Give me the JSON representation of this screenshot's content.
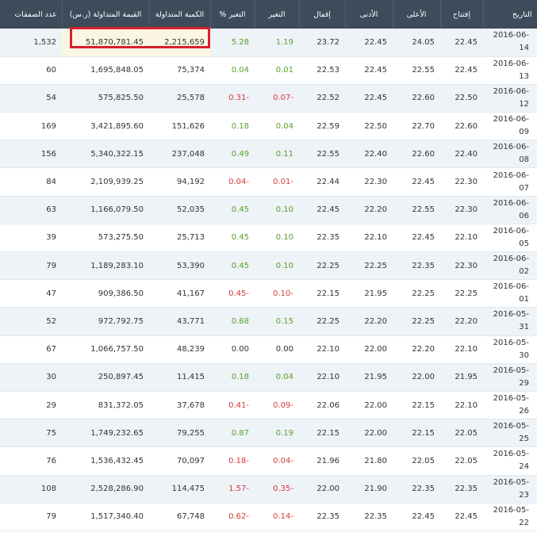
{
  "headers": {
    "trades": "عدد الصفقات",
    "value": "القيمة المتداولة (ر.س)",
    "volume": "الكمية المتداولة",
    "change_pct": "% التغير",
    "change": "التغير",
    "close": "إقفال",
    "low": "الأدنى",
    "high": "الأعلى",
    "open": "إفتتاح",
    "date": "التاريخ"
  },
  "rows": [
    {
      "trades": "1,532",
      "value": "51,870,781.45",
      "volume": "2,215,659",
      "pct": "5.28",
      "chg": "1.19",
      "close": "23.72",
      "low": "22.45",
      "high": "24.05",
      "open": "22.45",
      "date": "2016-06-14",
      "dir": "pos"
    },
    {
      "trades": "60",
      "value": "1,695,848.05",
      "volume": "75,374",
      "pct": "0.04",
      "chg": "0.01",
      "close": "22.53",
      "low": "22.45",
      "high": "22.55",
      "open": "22.45",
      "date": "2016-06-13",
      "dir": "pos"
    },
    {
      "trades": "54",
      "value": "575,825.50",
      "volume": "25,578",
      "pct": "0.31-",
      "chg": "0.07-",
      "close": "22.52",
      "low": "22.45",
      "high": "22.60",
      "open": "22.50",
      "date": "2016-06-12",
      "dir": "neg"
    },
    {
      "trades": "169",
      "value": "3,421,895.60",
      "volume": "151,626",
      "pct": "0.18",
      "chg": "0.04",
      "close": "22.59",
      "low": "22.50",
      "high": "22.70",
      "open": "22.60",
      "date": "2016-06-09",
      "dir": "pos"
    },
    {
      "trades": "156",
      "value": "5,340,322.15",
      "volume": "237,048",
      "pct": "0.49",
      "chg": "0.11",
      "close": "22.55",
      "low": "22.40",
      "high": "22.60",
      "open": "22.40",
      "date": "2016-06-08",
      "dir": "pos"
    },
    {
      "trades": "84",
      "value": "2,109,939.25",
      "volume": "94,192",
      "pct": "0.04-",
      "chg": "0.01-",
      "close": "22.44",
      "low": "22.30",
      "high": "22.45",
      "open": "22.30",
      "date": "2016-06-07",
      "dir": "neg"
    },
    {
      "trades": "63",
      "value": "1,166,079.50",
      "volume": "52,035",
      "pct": "0.45",
      "chg": "0.10",
      "close": "22.45",
      "low": "22.20",
      "high": "22.55",
      "open": "22.30",
      "date": "2016-06-06",
      "dir": "pos"
    },
    {
      "trades": "39",
      "value": "573,275.50",
      "volume": "25,713",
      "pct": "0.45",
      "chg": "0.10",
      "close": "22.35",
      "low": "22.10",
      "high": "22.45",
      "open": "22.10",
      "date": "2016-06-05",
      "dir": "pos"
    },
    {
      "trades": "79",
      "value": "1,189,283.10",
      "volume": "53,390",
      "pct": "0.45",
      "chg": "0.10",
      "close": "22.25",
      "low": "22.25",
      "high": "22.35",
      "open": "22.30",
      "date": "2016-06-02",
      "dir": "pos"
    },
    {
      "trades": "47",
      "value": "909,386.50",
      "volume": "41,167",
      "pct": "0.45-",
      "chg": "0.10-",
      "close": "22.15",
      "low": "21.95",
      "high": "22.25",
      "open": "22.25",
      "date": "2016-06-01",
      "dir": "neg"
    },
    {
      "trades": "52",
      "value": "972,792.75",
      "volume": "43,771",
      "pct": "0.68",
      "chg": "0.15",
      "close": "22.25",
      "low": "22.20",
      "high": "22.25",
      "open": "22.20",
      "date": "2016-05-31",
      "dir": "pos"
    },
    {
      "trades": "67",
      "value": "1,066,757.50",
      "volume": "48,239",
      "pct": "0.00",
      "chg": "0.00",
      "close": "22.10",
      "low": "22.00",
      "high": "22.20",
      "open": "22.10",
      "date": "2016-05-30",
      "dir": "zero"
    },
    {
      "trades": "30",
      "value": "250,897.45",
      "volume": "11,415",
      "pct": "0.18",
      "chg": "0.04",
      "close": "22.10",
      "low": "21.95",
      "high": "22.00",
      "open": "21.95",
      "date": "2016-05-29",
      "dir": "pos"
    },
    {
      "trades": "29",
      "value": "831,372.05",
      "volume": "37,678",
      "pct": "0.41-",
      "chg": "0.09-",
      "close": "22.06",
      "low": "22.00",
      "high": "22.15",
      "open": "22.10",
      "date": "2016-05-26",
      "dir": "neg"
    },
    {
      "trades": "75",
      "value": "1,749,232.65",
      "volume": "79,255",
      "pct": "0.87",
      "chg": "0.19",
      "close": "22.15",
      "low": "22.00",
      "high": "22.15",
      "open": "22.05",
      "date": "2016-05-25",
      "dir": "pos"
    },
    {
      "trades": "76",
      "value": "1,536,432.45",
      "volume": "70,097",
      "pct": "0.18-",
      "chg": "0.04-",
      "close": "21.96",
      "low": "21.80",
      "high": "22.05",
      "open": "22.05",
      "date": "2016-05-24",
      "dir": "neg"
    },
    {
      "trades": "108",
      "value": "2,528,286.90",
      "volume": "114,475",
      "pct": "1.57-",
      "chg": "0.35-",
      "close": "22.00",
      "low": "21.90",
      "high": "22.35",
      "open": "22.35",
      "date": "2016-05-23",
      "dir": "neg"
    },
    {
      "trades": "79",
      "value": "1,517,340.40",
      "volume": "67,748",
      "pct": "0.62-",
      "chg": "0.14-",
      "close": "22.35",
      "low": "22.35",
      "high": "22.45",
      "open": "22.45",
      "date": "2016-05-22",
      "dir": "neg"
    }
  ]
}
